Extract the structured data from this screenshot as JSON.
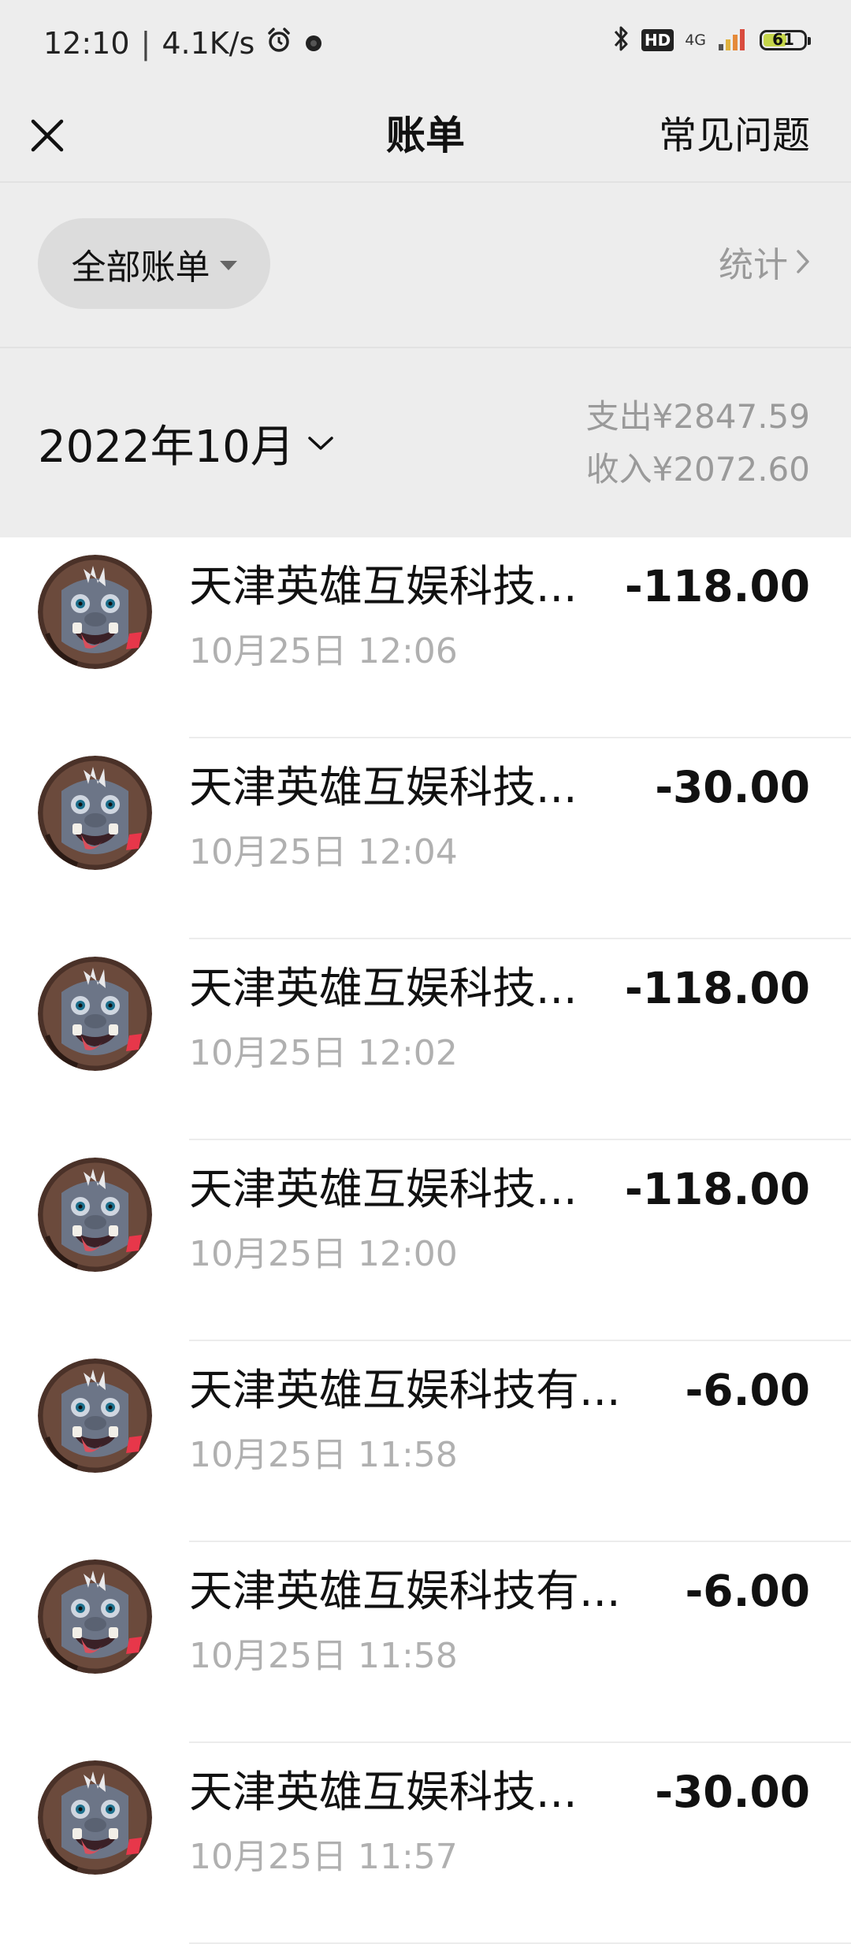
{
  "status_bar": {
    "time": "12:10",
    "separator": "|",
    "net_speed": "4.1K/s",
    "hd": "HD",
    "network": "4G",
    "battery": "61",
    "battery_level": 0.61
  },
  "nav": {
    "title": "账单",
    "faq": "常见问题"
  },
  "filter": {
    "all_bills": "全部账单",
    "stats": "统计"
  },
  "month": {
    "label": "2022年10月",
    "expense": "支出¥2847.59",
    "income": "收入¥2072.60"
  },
  "bills": [
    {
      "name": "天津英雄互娱科技...",
      "time": "10月25日 12:06",
      "amount": "-118.00"
    },
    {
      "name": "天津英雄互娱科技...",
      "time": "10月25日 12:04",
      "amount": "-30.00"
    },
    {
      "name": "天津英雄互娱科技...",
      "time": "10月25日 12:02",
      "amount": "-118.00"
    },
    {
      "name": "天津英雄互娱科技...",
      "time": "10月25日 12:00",
      "amount": "-118.00"
    },
    {
      "name": "天津英雄互娱科技有...",
      "time": "10月25日 11:58",
      "amount": "-6.00"
    },
    {
      "name": "天津英雄互娱科技有...",
      "time": "10月25日 11:58",
      "amount": "-6.00"
    },
    {
      "name": "天津英雄互娱科技...",
      "time": "10月25日 11:57",
      "amount": "-30.00"
    }
  ],
  "icons": {
    "close": "close-icon",
    "dropdown": "triangle-down-icon",
    "stats_arrow": "chevron-right-icon",
    "month_arrow": "chevron-down-icon",
    "avatar": "monster-avatar"
  }
}
